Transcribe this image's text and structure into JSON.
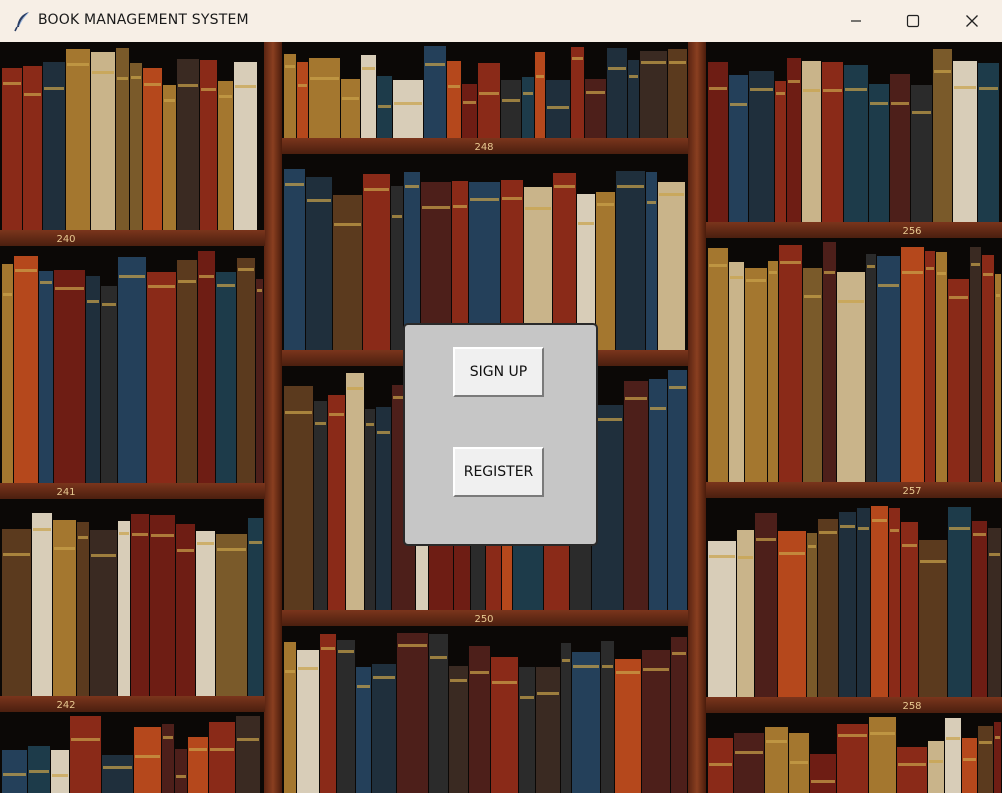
{
  "window": {
    "title": "BOOK MANAGEMENT SYSTEM",
    "icon": "feather-icon",
    "controls": {
      "minimize": "minimize-icon",
      "maximize": "maximize-icon",
      "close": "close-icon"
    }
  },
  "background": {
    "description_icon": "bookshelf-image",
    "shelf_labels": [
      "240",
      "248",
      "256",
      "241",
      "257",
      "250",
      "242",
      "258"
    ]
  },
  "dialog": {
    "buttons": {
      "sign_up": "SIGN UP",
      "register": "REGISTER"
    }
  },
  "colors": {
    "titlebar": "#f7efe6",
    "dialog_bg": "#c6c6c6",
    "button_bg": "#f0f0f0",
    "shelf_wood": "#6b2e18"
  }
}
